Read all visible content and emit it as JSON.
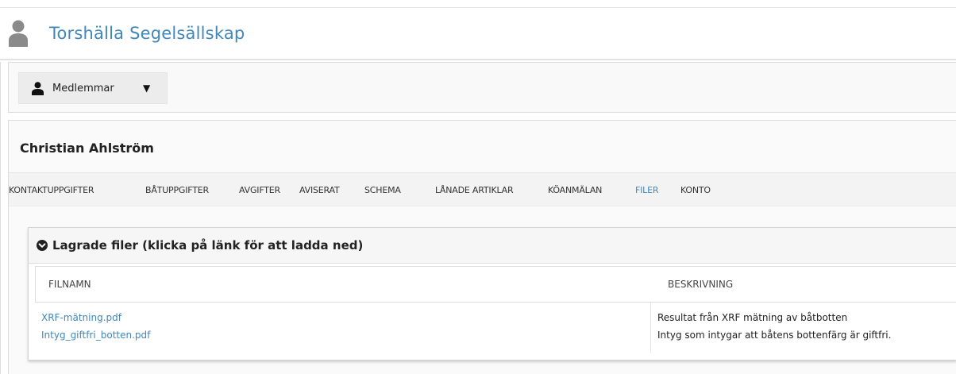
{
  "header": {
    "org_name": "Torshälla Segelsällskap",
    "icon": "user-silhouette-icon"
  },
  "toolbar": {
    "menu_label": "Medlemmar",
    "menu_icon": "person-icon",
    "caret_icon": "caret-down-icon",
    "caret_glyph": "▼"
  },
  "member": {
    "name": "Christian Ahlström"
  },
  "tabs": [
    {
      "label": "KONTAKTUPPGIFTER",
      "active": false
    },
    {
      "label": "BÅTUPPGIFTER",
      "active": false
    },
    {
      "label": "AVGIFTER",
      "active": false
    },
    {
      "label": "AVISERAT",
      "active": false
    },
    {
      "label": "SCHEMA",
      "active": false
    },
    {
      "label": "LÅNADE ARTIKLAR",
      "active": false
    },
    {
      "label": "KÖANMÄLAN",
      "active": false
    },
    {
      "label": "FILER",
      "active": true
    },
    {
      "label": "KONTO",
      "active": false
    }
  ],
  "files": {
    "title": "Lagrade filer (klicka på länk för att ladda ned)",
    "toggle_icon": "chevron-circle-down-icon",
    "columns": {
      "name": "FILNAMN",
      "description": "BESKRIVNING"
    },
    "rows": [
      {
        "filename": "XRF-mätning.pdf",
        "description": "Resultat från XRF mätning av båtbotten"
      },
      {
        "filename": "Intyg_giftfri_botten.pdf",
        "description": "Intyg som intygar att båtens bottenfärg är giftfri."
      }
    ]
  },
  "colors": {
    "accent": "#3f87bd",
    "text": "#222222",
    "border": "#dcdcdc"
  }
}
